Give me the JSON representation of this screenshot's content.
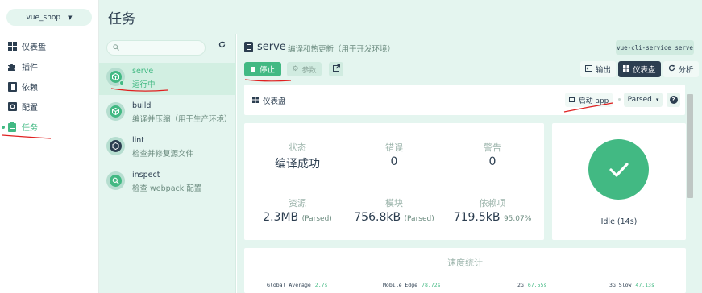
{
  "project": {
    "name": "vue_shop"
  },
  "nav": {
    "items": [
      {
        "label": "仪表盘",
        "icon": "dashboard-icon"
      },
      {
        "label": "插件",
        "icon": "puzzle-icon"
      },
      {
        "label": "依赖",
        "icon": "book-icon"
      },
      {
        "label": "配置",
        "icon": "gear-box-icon"
      },
      {
        "label": "任务",
        "icon": "clipboard-icon",
        "active": true
      }
    ]
  },
  "header": {
    "title": "任务"
  },
  "tasks": {
    "search_placeholder": "",
    "items": [
      {
        "name": "serve",
        "desc": "运行中",
        "selected": true
      },
      {
        "name": "build",
        "desc": "编译并压缩（用于生产环境）"
      },
      {
        "name": "lint",
        "desc": "检查并修复源文件"
      },
      {
        "name": "inspect",
        "desc": "检查 webpack 配置"
      }
    ]
  },
  "task_detail": {
    "name": "serve",
    "description": "编译和热更新（用于开发环境）",
    "command": "vue-cli-service serve",
    "stop_label": "停止",
    "params_label": "参数",
    "views": [
      {
        "label": "输出",
        "icon": "terminal-icon"
      },
      {
        "label": "仪表盘",
        "icon": "dashboard-icon",
        "active": true
      },
      {
        "label": "分析",
        "icon": "refresh-icon"
      }
    ]
  },
  "dashboard": {
    "title": "仪表盘",
    "launch_label": "启动 app",
    "mode": "Parsed",
    "stats": {
      "status_label": "状态",
      "status_value": "编译成功",
      "errors_label": "错误",
      "errors_value": "0",
      "warnings_label": "警告",
      "warnings_value": "0",
      "assets_label": "资源",
      "assets_value": "2.3MB",
      "assets_sub": "(Parsed)",
      "modules_label": "模块",
      "modules_value": "756.8kB",
      "modules_sub": "(Parsed)",
      "deps_label": "依赖项",
      "deps_value": "719.5kB",
      "deps_sub": "95.07%"
    },
    "status_text": "Idle (14s)",
    "speed": {
      "title": "速度统计",
      "items": [
        {
          "label": "Global Average",
          "value": "2.7s"
        },
        {
          "label": "Mobile Edge",
          "value": "78.72s"
        },
        {
          "label": "2G",
          "value": "67.55s"
        },
        {
          "label": "3G Slow",
          "value": "47.13s"
        }
      ]
    }
  },
  "colors": {
    "accent": "#42b983",
    "dark": "#2c3e50",
    "tint": "#e4f5ef",
    "annotation": "#e02020"
  }
}
